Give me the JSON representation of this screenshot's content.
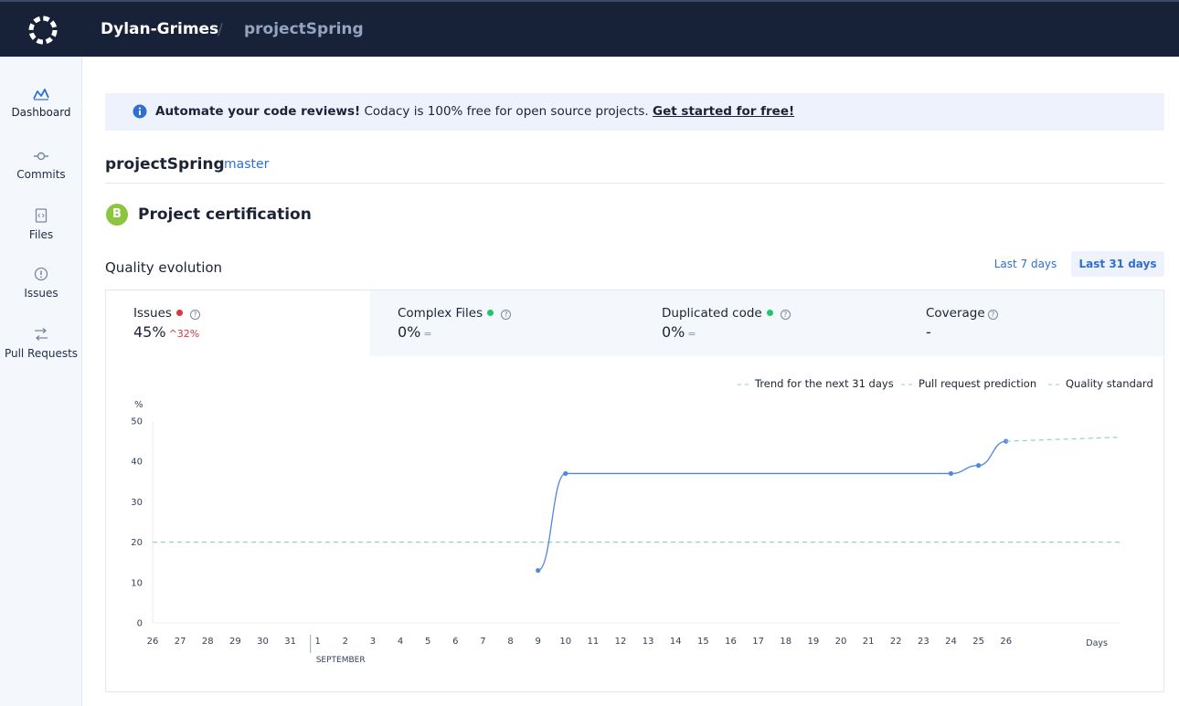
{
  "header": {
    "owner": "Dylan-Grimes",
    "separator": "/",
    "project": "projectSpring",
    "logo_icon": "codacy-logo-icon"
  },
  "sidebar": {
    "items": [
      {
        "label": "Dashboard",
        "icon": "chart-icon",
        "active": true
      },
      {
        "label": "Commits",
        "icon": "commit-icon"
      },
      {
        "label": "Files",
        "icon": "file-icon"
      },
      {
        "label": "Issues",
        "icon": "issue-icon"
      },
      {
        "label": "Pull Requests",
        "icon": "pull-request-icon"
      }
    ]
  },
  "banner": {
    "bold": "Automate your code reviews!",
    "text": " Codacy is 100% free for open source projects. ",
    "link": "Get started for free!"
  },
  "project": {
    "title": "projectSpring",
    "branch": "master"
  },
  "certification": {
    "grade": "B",
    "title": "Project certification"
  },
  "quality": {
    "title": "Quality evolution",
    "ranges": [
      "Last 7 days",
      "Last 31 days"
    ],
    "selected_range": "Last 31 days"
  },
  "metrics": [
    {
      "name": "Issues",
      "value": "45%",
      "delta": "^32%",
      "status": "bad",
      "help": "?"
    },
    {
      "name": "Complex Files",
      "value": "0%",
      "delta": "=",
      "status": "good",
      "help": "?"
    },
    {
      "name": "Duplicated code",
      "value": "0%",
      "delta": "=",
      "status": "good",
      "help": "?"
    },
    {
      "name": "Coverage",
      "value": "-",
      "delta": "",
      "status": "none",
      "help": "?"
    }
  ],
  "colors": {
    "accent": "#2f6fd1",
    "bad": "#d9363e",
    "good": "#21c56a",
    "grade": "#8cc63f",
    "line": "#4f86e0",
    "trend": "#8fd3c7"
  },
  "chart_data": {
    "type": "line",
    "ylabel": "%",
    "xlabel": "Days",
    "month_label": "SEPTEMBER",
    "ylim": [
      0,
      50
    ],
    "yticks": [
      0,
      10,
      20,
      30,
      40,
      50
    ],
    "categories": [
      "26",
      "27",
      "28",
      "29",
      "30",
      "31",
      "1",
      "2",
      "3",
      "4",
      "5",
      "6",
      "7",
      "8",
      "9",
      "10",
      "11",
      "12",
      "13",
      "14",
      "15",
      "16",
      "17",
      "18",
      "19",
      "20",
      "21",
      "22",
      "23",
      "24",
      "25",
      "26"
    ],
    "legend": [
      "Trend for the next 31 days",
      "Pull request prediction",
      "Quality standard"
    ],
    "legend_position": "top-right",
    "series": [
      {
        "name": "Issues",
        "points": [
          {
            "x": "9",
            "y": 13
          },
          {
            "x": "10",
            "y": 37
          },
          {
            "x": "24",
            "y": 37
          },
          {
            "x": "25",
            "y": 39
          },
          {
            "x": "26",
            "y": 45
          }
        ]
      }
    ],
    "trend_end_y": 46,
    "quality_standard": 20
  }
}
